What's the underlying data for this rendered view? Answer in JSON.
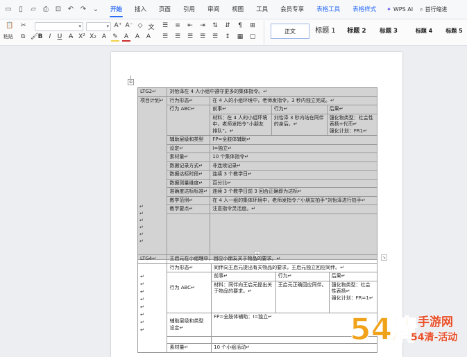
{
  "quick_access": {
    "icons": [
      "save-icon",
      "undo-history-icon",
      "open-icon",
      "print-icon",
      "print-preview-icon",
      "undo-icon",
      "redo-icon",
      "more-icon"
    ]
  },
  "menu": {
    "tabs": [
      "开始",
      "插入",
      "页面",
      "引用",
      "审阅",
      "视图",
      "工具",
      "会员专享"
    ],
    "context_tabs": [
      "表格工具",
      "表格样式"
    ],
    "wps_ai": "WPS AI",
    "search": "首行缩进"
  },
  "toolbar": {
    "paste_label": "粘贴",
    "font_color": "#cc2b2b",
    "highlight_color": "#f3d34a",
    "styles": [
      "正文",
      "标题 1",
      "标题 2",
      "标题 3",
      "标题 4",
      "标题 5"
    ]
  },
  "table1": {
    "col1_row1": "LTG2↵",
    "col1_row2": "项目计划↵",
    "r1_text": "刘怡泽在 4 人小组中遵守更多的集体指令。↵",
    "r2_label": "行为形态↵",
    "r2_text": "在 4 人的小组环境中，老师发指令，3 秒内独立完成。↵",
    "r3_label": "行为 ABC↵",
    "antecedent_h": "前事↵",
    "antecedent_1": "材料：在 4 人的小组环境",
    "antecedent_2": "中，老师发指令“小朋友",
    "antecedent_3": "排队”。↵",
    "behavior_h": "行为↵",
    "behavior_1": "刘怡泽 3 秒内站在同伴",
    "behavior_2": "的身后。↵",
    "consequence_h": "后果↵",
    "consequence_1": "强化物类型：社会性",
    "consequence_2": "表扬+代币↵",
    "consequence_3": "强化计划：FR1↵",
    "rows": [
      {
        "label": "辅助层级和类型",
        "value": "FP=全肢体辅助↵"
      },
      {
        "label": "设定↵",
        "value": "I=独立↵"
      },
      {
        "label": "素材量↵",
        "value": "10 个集体指令↵"
      },
      {
        "label": "数据记录方式↵",
        "value": "非连续记录↵"
      },
      {
        "label": "数据达标时段↵",
        "value": "连续 3 个教学日↵"
      },
      {
        "label": "数据测量维度↵",
        "value": "百分比↵"
      },
      {
        "label": "准确度达标标准↵",
        "value": "连续 3 个教学日前 3 回合正确即为达标↵"
      },
      {
        "label": "教学范例↵",
        "value": "在 4 人一组的集体环境中，老师发指令:“小朋友拍手”刘怡泽进行拍手↵"
      },
      {
        "label": "教学要点↵",
        "value": "注意指令灵活度。↵"
      }
    ],
    "empty_marks": [
      "↵",
      "↵",
      "↵",
      "↵",
      "↵",
      "↵"
    ]
  },
  "table2": {
    "col1_row1": "LTG4↵",
    "r1_text": "王启元在小组理中，回应小朋友关于物品的要求。↵",
    "r2_label": "行为形态↵",
    "r2_text": "同伴向王启元提出有关物品的要求，王启元独立回应同伴。↵",
    "r3_label": "行为 ABC↵",
    "antecedent_h": "前事↵",
    "antecedent_1": "材料：同伴向王启元提出关",
    "antecedent_2": "于物品的要求。↵",
    "behavior_h": "行为↵",
    "behavior_1": "王启元正确回应同伴。",
    "consequence_h": "后果↵",
    "consequence_1": "强化物类型：社会",
    "consequence_2": "性表扬↵",
    "consequence_3": "强化计划：FR=1↵",
    "rows": [
      {
        "label": "辅助层级和类型",
        "value": "FP=全肢体辅助：I=独立↵"
      },
      {
        "label": "设定↵",
        "value": ""
      },
      {
        "label": "素材量↵",
        "value": "10 个小组活动↵"
      }
    ],
    "empty_marks": [
      "↵",
      "↵",
      "↵",
      "↵",
      "↵",
      "↵",
      "↵",
      "↵"
    ]
  },
  "watermark": {
    "text": "手游网",
    "site": "54清-活动"
  }
}
